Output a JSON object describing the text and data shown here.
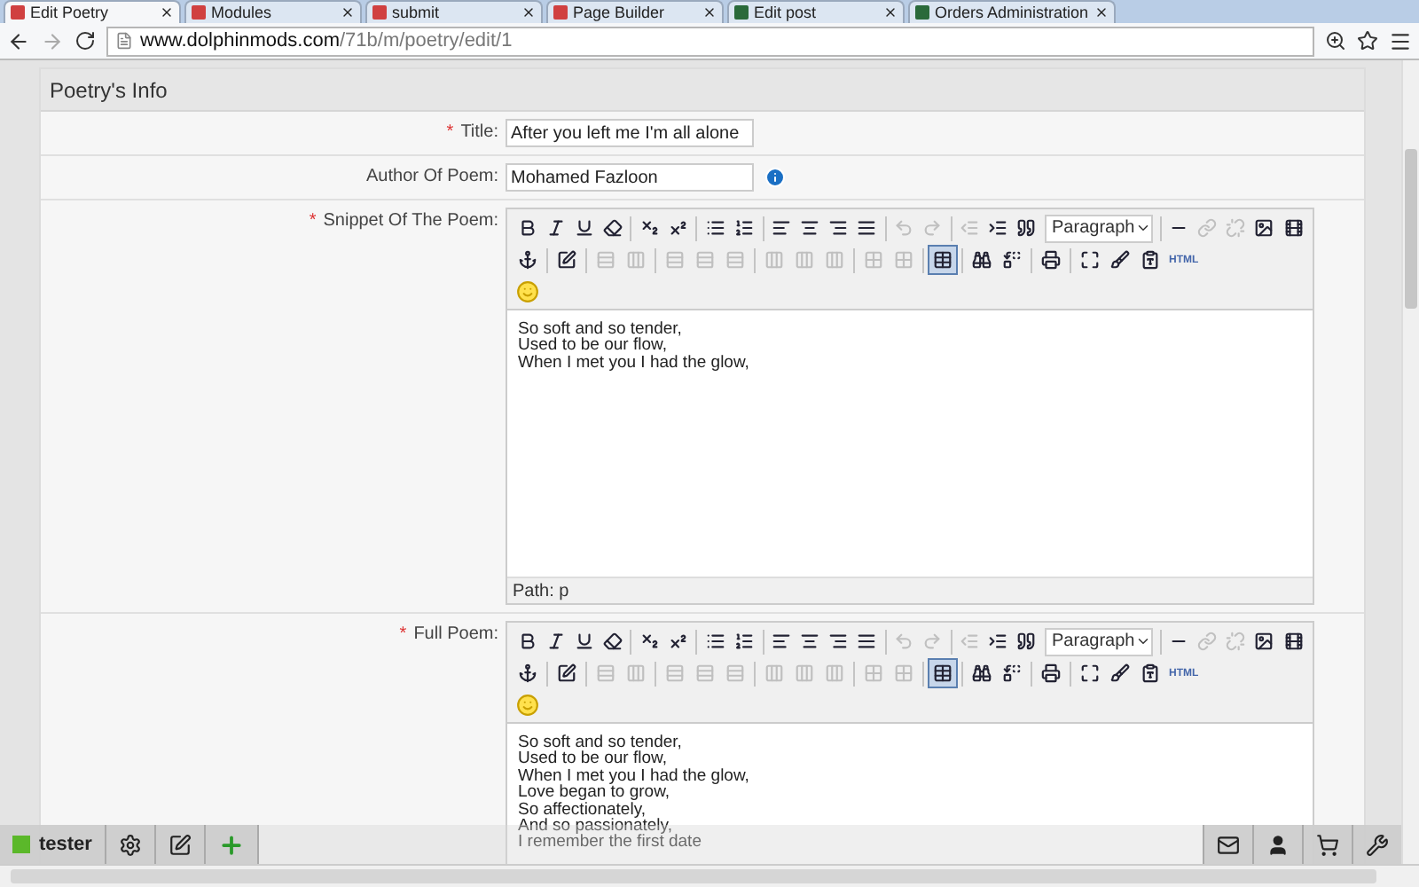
{
  "browser": {
    "tabs": [
      {
        "label": "Edit Poetry",
        "selected": true,
        "color": "#d04040"
      },
      {
        "label": "Modules",
        "selected": false,
        "color": "#d04040"
      },
      {
        "label": "submit",
        "selected": false,
        "color": "#d04040"
      },
      {
        "label": "Page Builder",
        "selected": false,
        "color": "#d04040"
      },
      {
        "label": "Edit post",
        "selected": false,
        "color": "#2a6a3a"
      },
      {
        "label": "Orders Administration",
        "selected": false,
        "color": "#2a6a3a"
      }
    ],
    "address": {
      "host": "www.dolphinmods.com",
      "path": "/71b/m/poetry/edit/1"
    }
  },
  "form": {
    "title": "Poetry's Info",
    "fields": [
      {
        "kind": "text",
        "label": "Title:",
        "required_mark": "*",
        "value": "After you left me I'm all alone",
        "info": false
      },
      {
        "kind": "text",
        "label": "Author Of Poem:",
        "value": "Mohamed Fazloon",
        "info": true
      },
      {
        "kind": "editor",
        "label": "Snippet Of The Poem:",
        "required_mark": "*",
        "format": "Paragraph",
        "html_label": "HTML",
        "lines": [
          "So soft and so tender,",
          "Used to be our flow,",
          "When I met you I had the glow,"
        ],
        "path": "Path: p"
      },
      {
        "kind": "editor",
        "label": "Full Poem:",
        "required_mark": "*",
        "format": "Paragraph",
        "html_label": "HTML",
        "lines": [
          "So soft and so tender,",
          "Used to be our flow,",
          "When I met you I had the glow,",
          "Love began to grow,",
          "So affectionately,",
          "And so passionately,",
          "I remember the first date"
        ]
      }
    ]
  },
  "toolbar": {
    "disabled": [
      false,
      false,
      false,
      false,
      false,
      false,
      false,
      false,
      false,
      false,
      false,
      false,
      true,
      true,
      true,
      false,
      false,
      false,
      true,
      true,
      false,
      false
    ],
    "disabled_row_2": [
      false,
      false,
      true,
      true,
      true,
      true,
      true,
      true,
      true,
      true,
      true,
      true,
      false,
      false,
      false,
      false,
      false,
      false,
      false
    ],
    "active_row_2": [
      false,
      false,
      false,
      false,
      false,
      false,
      false,
      false,
      false,
      false,
      false,
      false,
      true,
      false,
      false,
      false,
      false,
      false,
      false
    ]
  },
  "admin_bar": {
    "user": "tester"
  }
}
